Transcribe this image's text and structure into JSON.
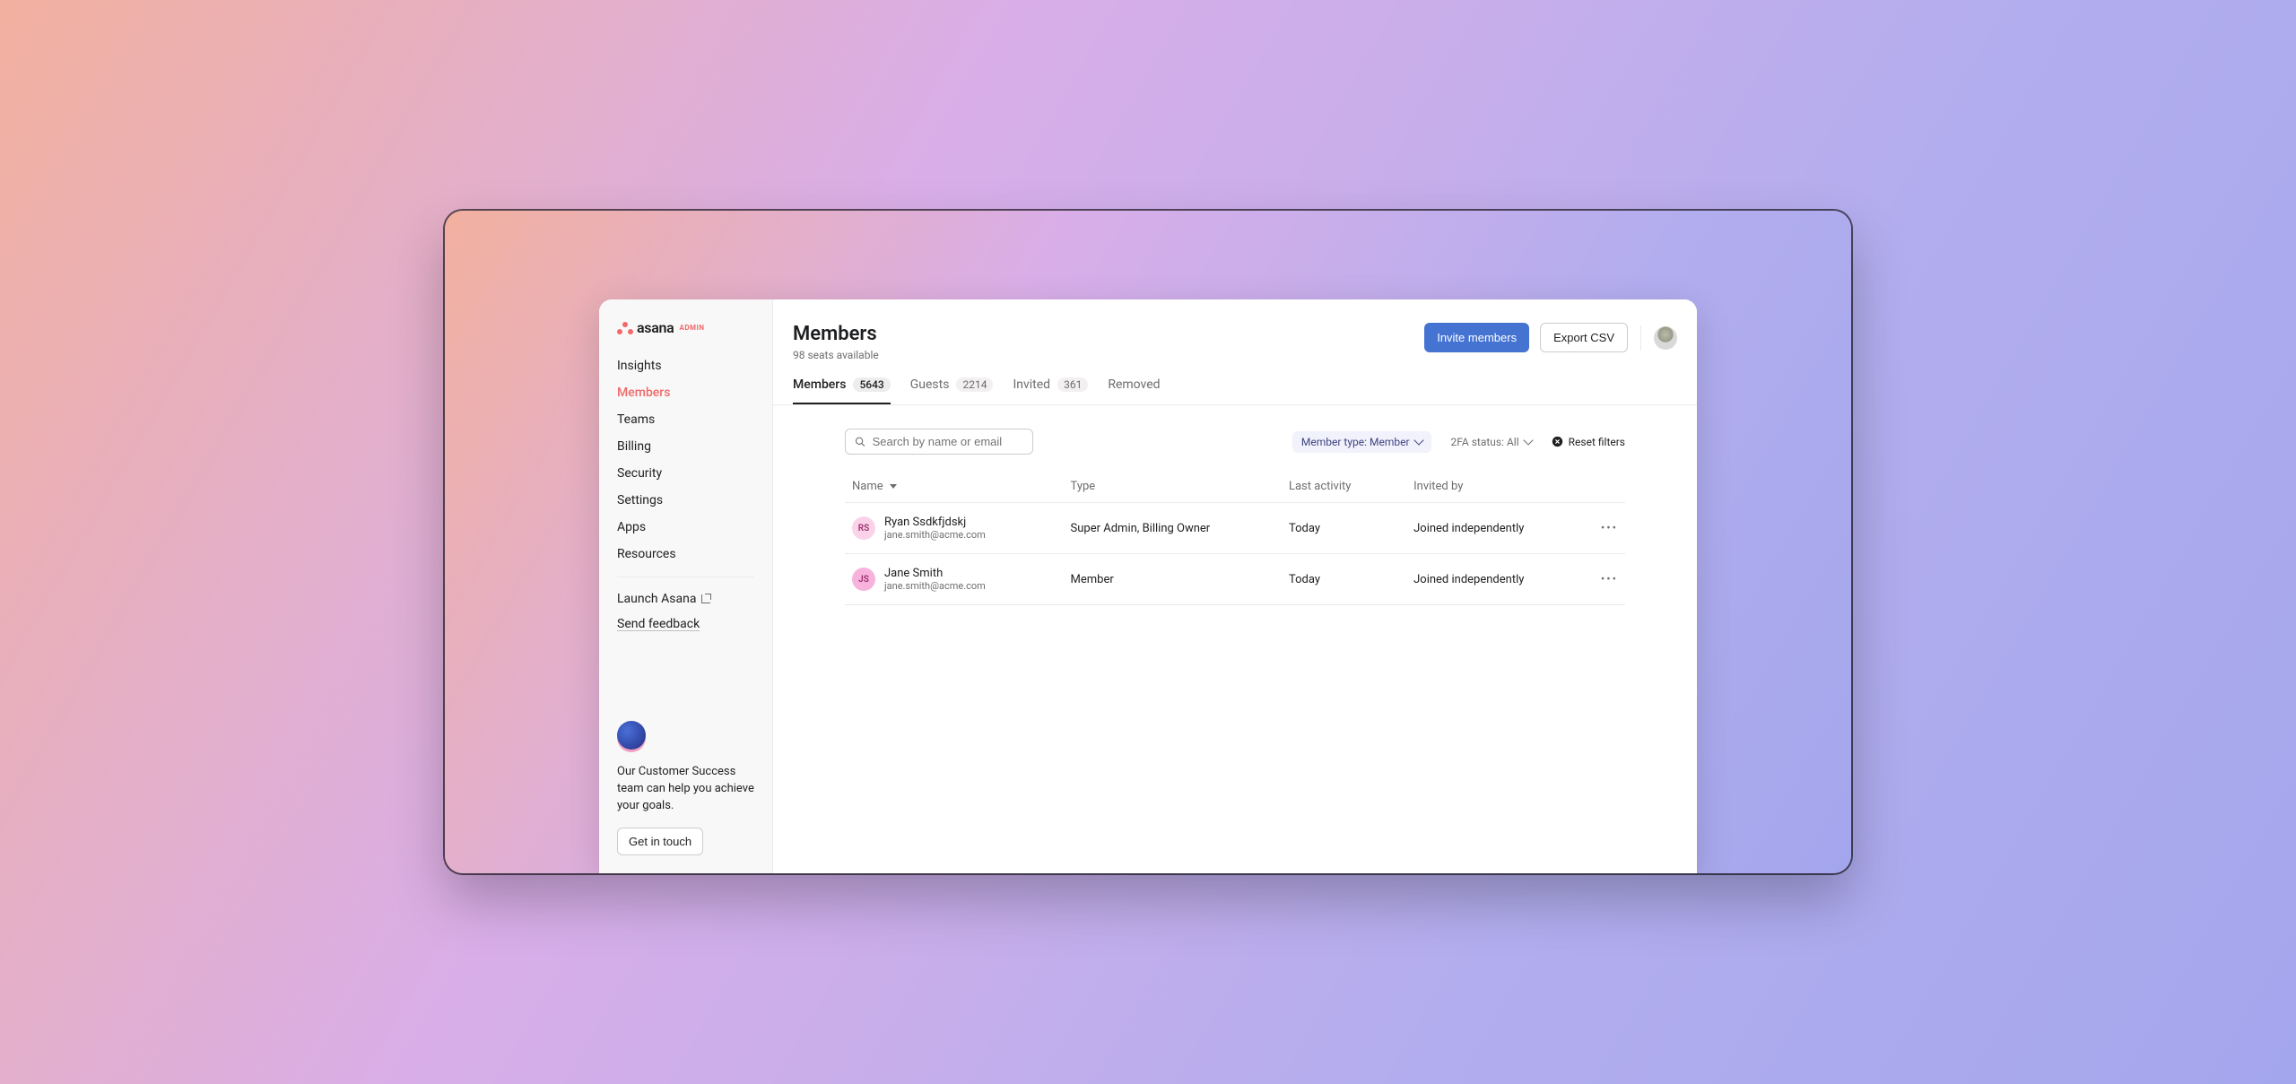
{
  "logo": {
    "brand": "asana",
    "admin": "ADMIN"
  },
  "sidebar": {
    "items": [
      {
        "label": "Insights"
      },
      {
        "label": "Members"
      },
      {
        "label": "Teams"
      },
      {
        "label": "Billing"
      },
      {
        "label": "Security"
      },
      {
        "label": "Settings"
      },
      {
        "label": "Apps"
      },
      {
        "label": "Resources"
      }
    ],
    "launch": "Launch Asana",
    "feedback": "Send feedback",
    "cs_text": "Our Customer Success team can help you achieve your goals.",
    "cs_button": "Get in touch"
  },
  "header": {
    "title": "Members",
    "subtitle": "98 seats available",
    "invite": "Invite members",
    "export": "Export CSV"
  },
  "tabs": [
    {
      "label": "Members",
      "count": "5643"
    },
    {
      "label": "Guests",
      "count": "2214"
    },
    {
      "label": "Invited",
      "count": "361"
    },
    {
      "label": "Removed",
      "count": ""
    }
  ],
  "filters": {
    "search_placeholder": "Search by name or email",
    "member_type": "Member type: Member",
    "twofa": "2FA status: All",
    "reset": "Reset filters"
  },
  "table": {
    "headers": {
      "name": "Name",
      "type": "Type",
      "activity": "Last activity",
      "invited": "Invited by"
    },
    "rows": [
      {
        "initials": "RS",
        "avatar_bg": "#fbd3e9",
        "name": "Ryan Ssdkfjdskj",
        "email": "jane.smith@acme.com",
        "type": "Super Admin, Billing Owner",
        "activity": "Today",
        "invited": "Joined independently"
      },
      {
        "initials": "JS",
        "avatar_bg": "#f8b3dd",
        "name": "Jane Smith",
        "email": "jane.smith@acme.com",
        "type": "Member",
        "activity": "Today",
        "invited": "Joined independently"
      }
    ]
  }
}
